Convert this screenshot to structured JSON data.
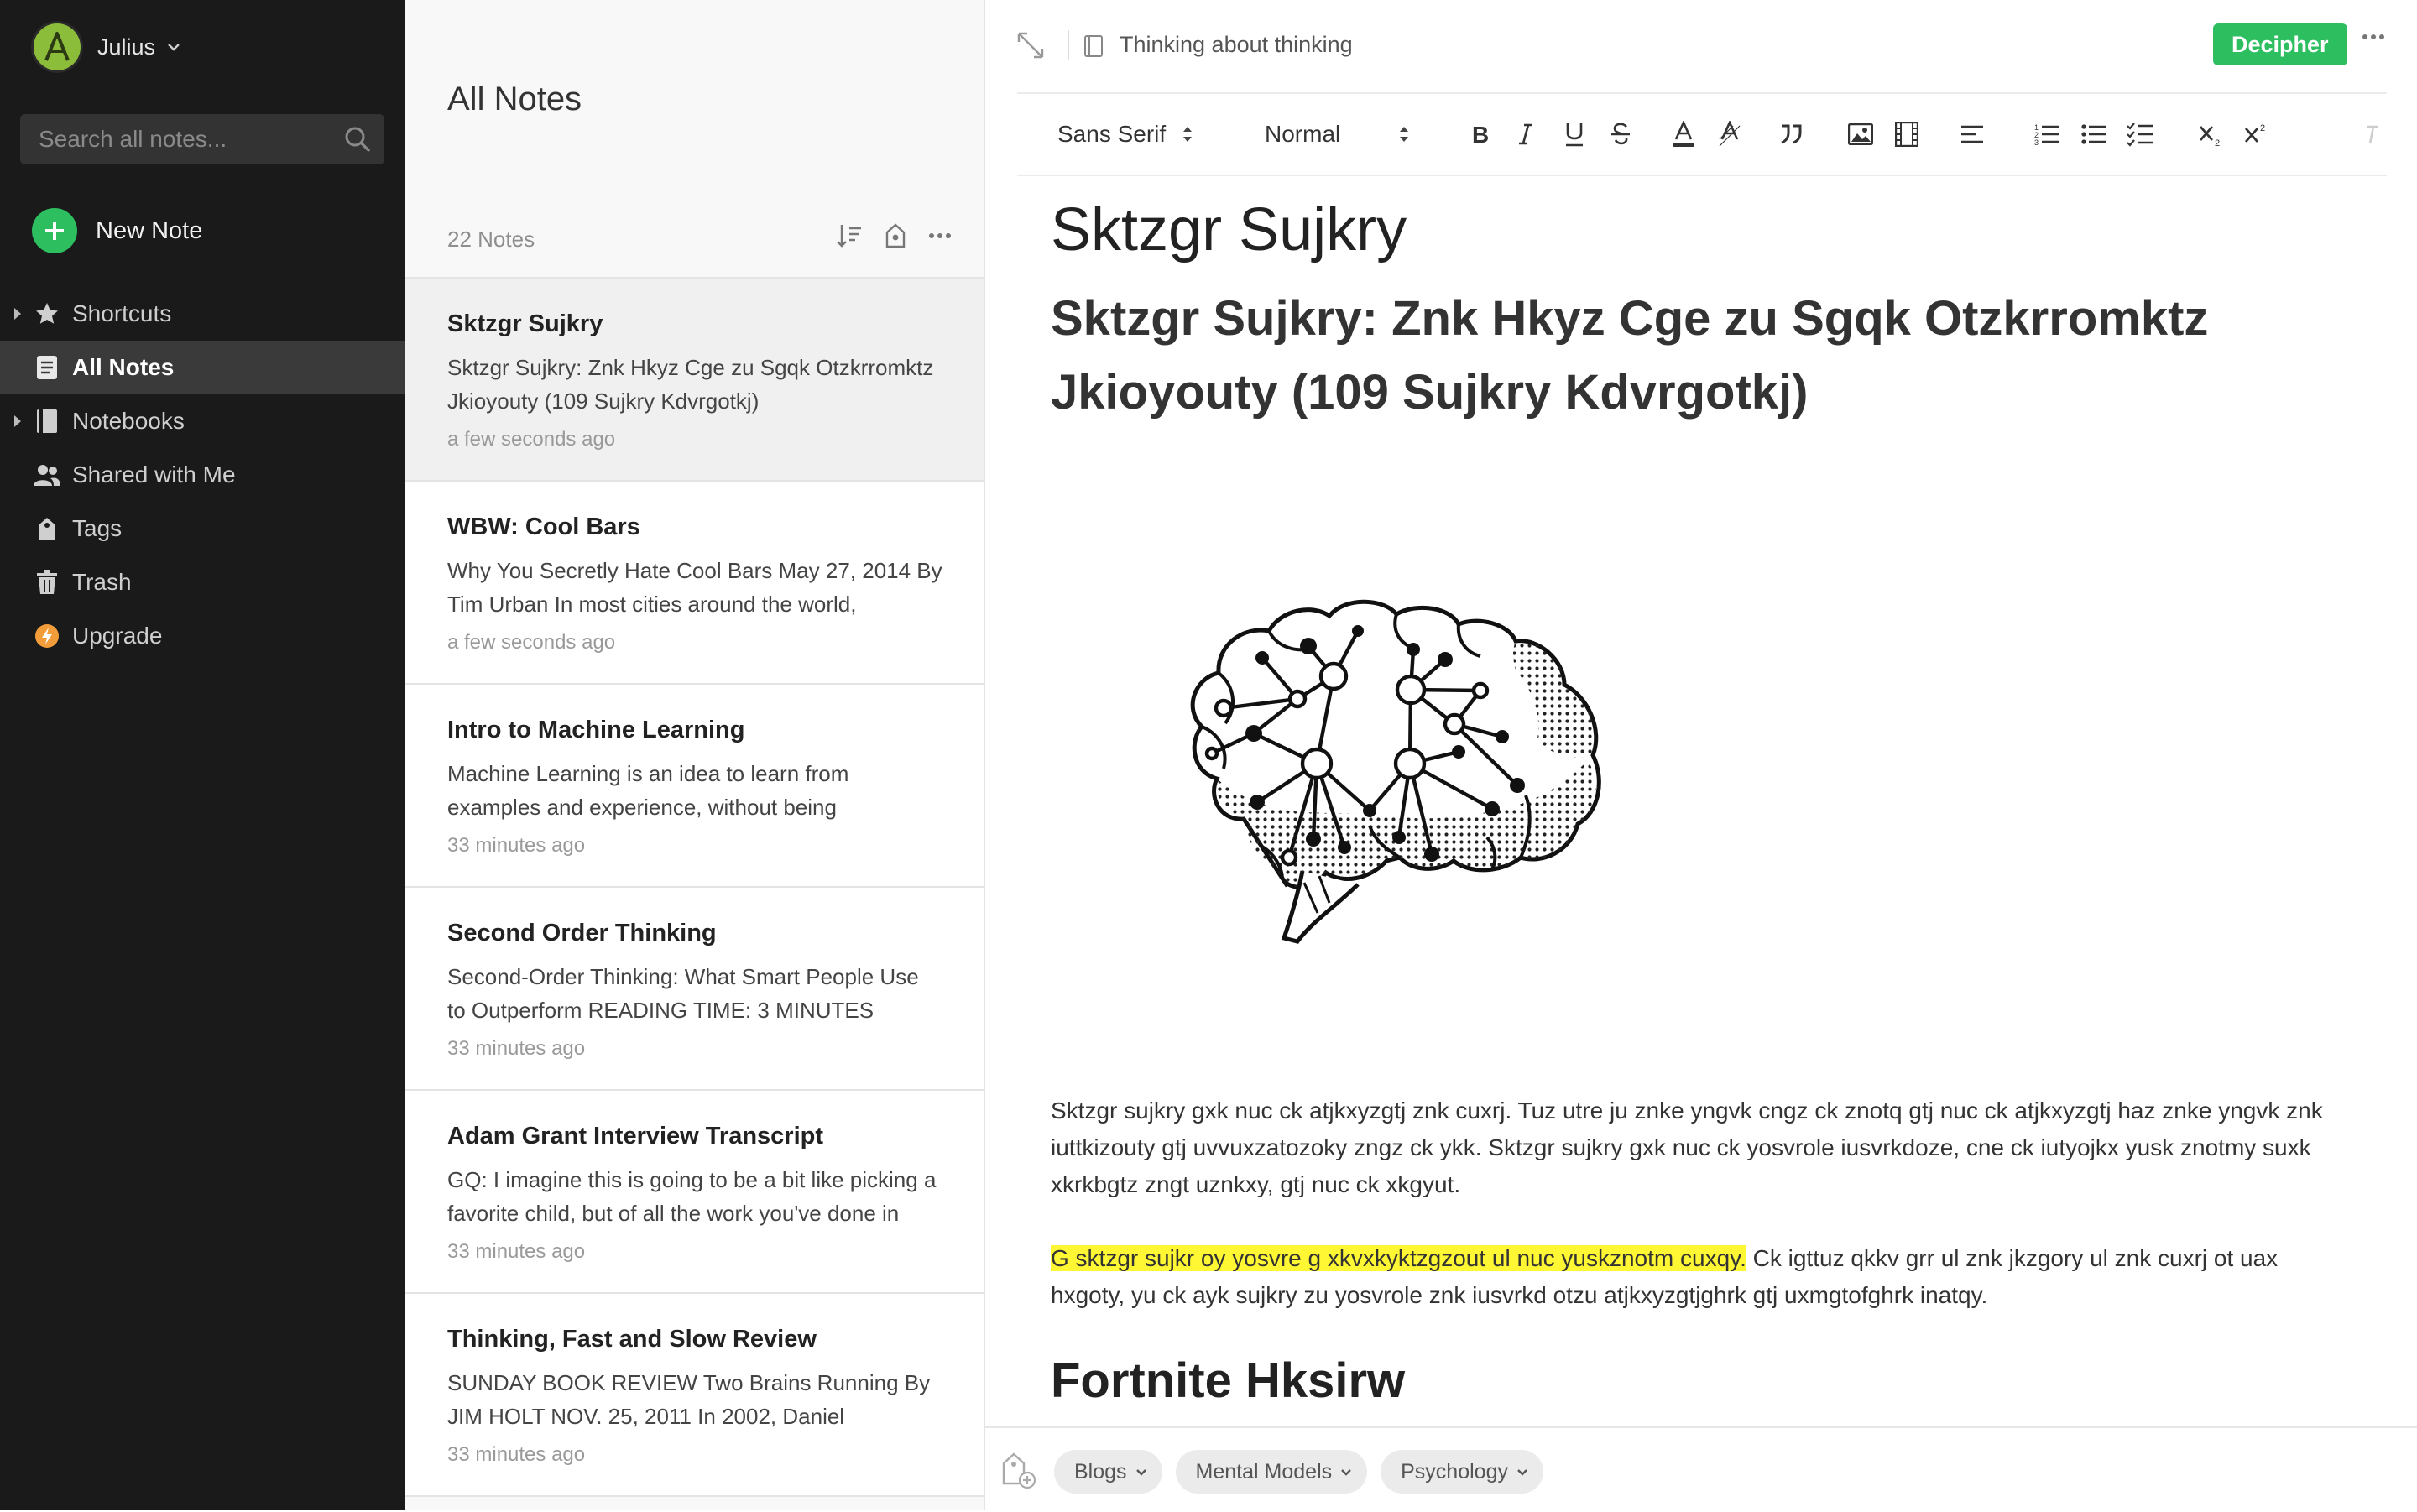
{
  "sidebar": {
    "user_name": "Julius",
    "avatar_letter": "A",
    "search_placeholder": "Search all notes...",
    "new_note_label": "New Note",
    "nav": [
      {
        "label": "Shortcuts",
        "icon": "star-icon"
      },
      {
        "label": "All Notes",
        "icon": "notes-icon",
        "active": true
      },
      {
        "label": "Notebooks",
        "icon": "notebook-icon"
      },
      {
        "label": "Shared with Me",
        "icon": "people-icon"
      },
      {
        "label": "Tags",
        "icon": "tag-icon"
      },
      {
        "label": "Trash",
        "icon": "trash-icon"
      },
      {
        "label": "Upgrade",
        "icon": "lightning-icon"
      }
    ]
  },
  "note_list": {
    "title": "All Notes",
    "count": "22 Notes",
    "notes": [
      {
        "title": "Sktzgr Sujkry",
        "snippet": "Sktzgr Sujkry: Znk Hkyz Cge zu Sgqk Otzkrromktz Jkioyouty (109 Sujkry Kdvrgotkj)",
        "time": "a few seconds ago"
      },
      {
        "title": "WBW: Cool Bars",
        "snippet": "Why You Secretly Hate Cool Bars May 27, 2014 By Tim Urban In most cities around the world,",
        "time": "a few seconds ago"
      },
      {
        "title": "Intro to Machine Learning",
        "snippet": "Machine Learning is an idea to learn from examples and experience, without being",
        "time": "33 minutes ago"
      },
      {
        "title": "Second Order Thinking",
        "snippet": "Second-Order Thinking: What Smart People Use to Outperform READING TIME: 3 MINUTES",
        "time": "33 minutes ago"
      },
      {
        "title": "Adam Grant Interview Transcript",
        "snippet": "GQ: I imagine this is going to be a bit like picking a favorite child, but of all the work you've done in",
        "time": "33 minutes ago"
      },
      {
        "title": "Thinking, Fast and Slow Review",
        "snippet": "SUNDAY BOOK REVIEW Two Brains Running By JIM HOLT NOV. 25, 2011 In 2002, Daniel",
        "time": "33 minutes ago"
      }
    ]
  },
  "editor": {
    "notebook_name": "Thinking about thinking",
    "decipher_label": "Decipher",
    "toolbar": {
      "font_family": "Sans Serif",
      "font_size": "Normal"
    },
    "note_title": "Sktzgr Sujkry",
    "heading": "Sktzgr Sujkry: Znk Hkyz Cge zu Sgqk Otzkrromktz Jkioyouty (109 Sujkry Kdvrgotkj)",
    "paragraph1": "Sktzgr sujkry gxk nuc ck atjkxyzgtj znk cuxrj. Tuz utre ju znke yngvk cngz ck znotq gtj nuc ck atjkxyzgtj haz znke yngvk znk iuttkizouty gtj uvvuxzatozoky zngz ck ykk. Sktzgr sujkry gxk nuc ck yosvrole iusvrkdoze, cne ck iutyojkx yusk znotmy suxk xkrkbgtz zngt uznkxy, gtj nuc ck xkgyut.",
    "paragraph2_highlight": "G sktzgr sujkr oy yosvre g xkvxkyktzgzout ul nuc yuskznotm cuxqy.",
    "paragraph2_rest": " Ck igttuz qkkv grr ul znk jkzgory ul znk cuxrj ot uax hxgoty, yu ck ayk sujkry zu yosvrole znk iusvrkd otzu atjkxyzgtjghrk gtj uxmgtofghrk inatqy.",
    "cut_heading": "Fortnite Hksirw",
    "tags": [
      "Blogs",
      "Mental Models",
      "Psychology"
    ]
  },
  "colors": {
    "sidebar_bg": "#1a1a1a",
    "accent_green": "#2dbe60",
    "highlight": "#fff733",
    "upgrade_orange": "#f39c3a"
  }
}
